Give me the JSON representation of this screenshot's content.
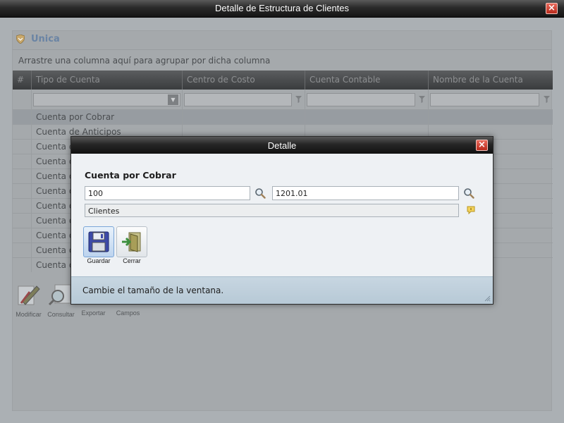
{
  "window": {
    "title": "Detalle de Estructura de Clientes"
  },
  "panel": {
    "title": "Unica",
    "group_hint": "Arrastre una columna aquí para agrupar por dicha columna"
  },
  "grid": {
    "columns": [
      "#",
      "Tipo de Cuenta",
      "Centro de Costo",
      "Cuenta Contable",
      "Nombre de la Cuenta"
    ],
    "rows": [
      "Cuenta por Cobrar",
      "Cuenta de Anticipos",
      "Cuenta d",
      "Cuenta d",
      "Cuenta d",
      "Cuenta d",
      "Cuenta d",
      "Cuenta d",
      "Cuenta d",
      "Cuenta d",
      "Cuenta d"
    ],
    "selected_row": 0
  },
  "toolbar": {
    "modificar": "Modificar",
    "consultar": "Consultar",
    "exportar": "Exportar",
    "campos": "Campos"
  },
  "dialog": {
    "title": "Detalle",
    "heading": "Cuenta por Cobrar",
    "centro_costo_value": "100",
    "cuenta_value": "1201.01",
    "nombre_value": "Clientes",
    "guardar_label": "Guardar",
    "cerrar_label": "Cerrar",
    "status": "Cambie el tamaño de la ventana."
  },
  "icons": {
    "close": "close-icon",
    "search": "search-icon",
    "filter": "filter-icon",
    "save": "floppy-disk-icon",
    "exit": "door-exit-icon"
  },
  "colors": {
    "titlebar": "#1c1c1c",
    "close_button": "#c8392b",
    "panel_title": "#6a84a4",
    "status_bar": "#c0d0dc"
  }
}
